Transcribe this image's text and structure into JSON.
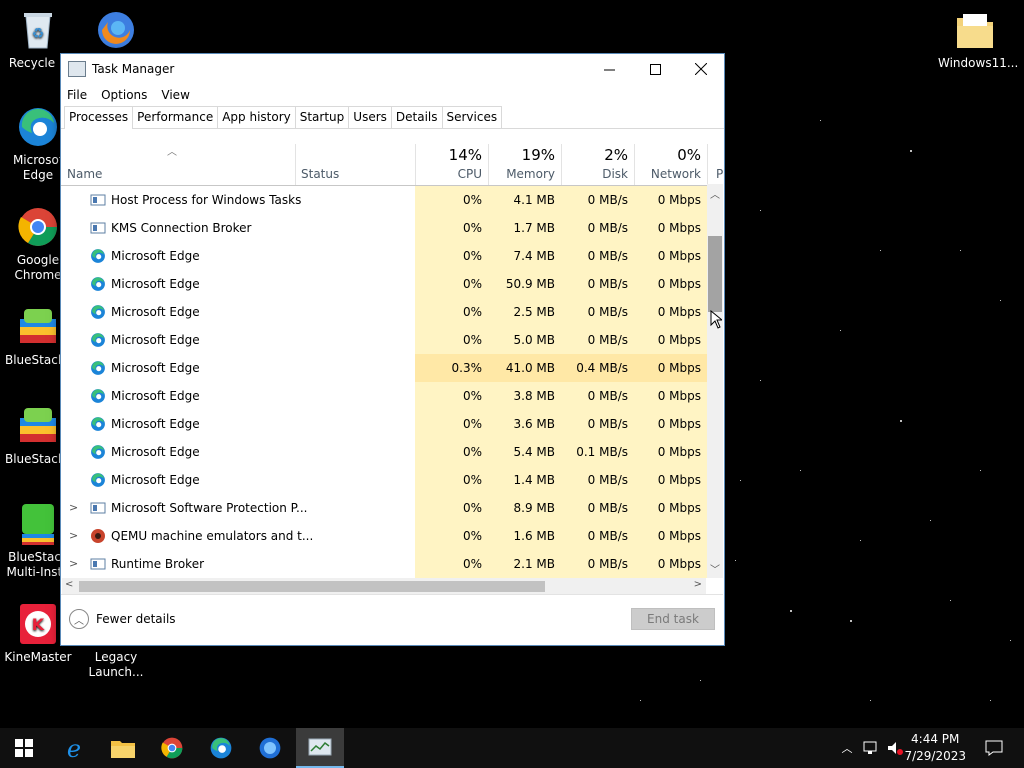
{
  "desktop": {
    "icons": [
      {
        "label": "Recycle B",
        "icon": "recycle-bin-icon"
      },
      {
        "label": "",
        "icon": "firefox-developer-icon"
      },
      {
        "label": "Microsof\nEdge",
        "icon": "edge-icon"
      },
      {
        "label": "Google\nChrome",
        "icon": "chrome-icon"
      },
      {
        "label": "BlueStacks",
        "icon": "bluestacks-icon"
      },
      {
        "label": "BlueStacks",
        "icon": "bluestacks-icon"
      },
      {
        "label": "BlueStack\nMulti-Insta",
        "icon": "bluestacks-multi-icon"
      },
      {
        "label": "KineMaster",
        "icon": "kinemaster-icon"
      },
      {
        "label": "Legacy\nLaunch...",
        "icon": "legacy-launcher-icon"
      },
      {
        "label": "Windows11...",
        "icon": "folder-icon"
      }
    ]
  },
  "window": {
    "title": "Task Manager",
    "menu": [
      "File",
      "Options",
      "View"
    ],
    "tabs": [
      "Processes",
      "Performance",
      "App history",
      "Startup",
      "Users",
      "Details",
      "Services"
    ],
    "active_tab": "Processes",
    "columns": {
      "name": "Name",
      "status": "Status",
      "cpu": {
        "pct": "14%",
        "label": "CPU"
      },
      "memory": {
        "pct": "19%",
        "label": "Memory"
      },
      "disk": {
        "pct": "2%",
        "label": "Disk"
      },
      "network": {
        "pct": "0%",
        "label": "Network"
      },
      "power": {
        "label": "P"
      }
    },
    "rows": [
      {
        "name": "Host Process for Windows Tasks",
        "cpu": "0%",
        "memory": "4.1 MB",
        "disk": "0 MB/s",
        "network": "0 Mbps",
        "icon": "system-app-icon",
        "expandable": false
      },
      {
        "name": "KMS Connection Broker",
        "cpu": "0%",
        "memory": "1.7 MB",
        "disk": "0 MB/s",
        "network": "0 Mbps",
        "icon": "system-app-icon",
        "expandable": false
      },
      {
        "name": "Microsoft Edge",
        "cpu": "0%",
        "memory": "7.4 MB",
        "disk": "0 MB/s",
        "network": "0 Mbps",
        "icon": "edge-icon",
        "expandable": false
      },
      {
        "name": "Microsoft Edge",
        "cpu": "0%",
        "memory": "50.9 MB",
        "disk": "0 MB/s",
        "network": "0 Mbps",
        "icon": "edge-icon",
        "expandable": false
      },
      {
        "name": "Microsoft Edge",
        "cpu": "0%",
        "memory": "2.5 MB",
        "disk": "0 MB/s",
        "network": "0 Mbps",
        "icon": "edge-icon",
        "expandable": false
      },
      {
        "name": "Microsoft Edge",
        "cpu": "0%",
        "memory": "5.0 MB",
        "disk": "0 MB/s",
        "network": "0 Mbps",
        "icon": "edge-icon",
        "expandable": false
      },
      {
        "name": "Microsoft Edge",
        "cpu": "0.3%",
        "memory": "41.0 MB",
        "disk": "0.4 MB/s",
        "network": "0 Mbps",
        "icon": "edge-icon",
        "expandable": false,
        "highlight": true
      },
      {
        "name": "Microsoft Edge",
        "cpu": "0%",
        "memory": "3.8 MB",
        "disk": "0 MB/s",
        "network": "0 Mbps",
        "icon": "edge-icon",
        "expandable": false
      },
      {
        "name": "Microsoft Edge",
        "cpu": "0%",
        "memory": "3.6 MB",
        "disk": "0 MB/s",
        "network": "0 Mbps",
        "icon": "edge-icon",
        "expandable": false
      },
      {
        "name": "Microsoft Edge",
        "cpu": "0%",
        "memory": "5.4 MB",
        "disk": "0.1 MB/s",
        "network": "0 Mbps",
        "icon": "edge-icon",
        "expandable": false
      },
      {
        "name": "Microsoft Edge",
        "cpu": "0%",
        "memory": "1.4 MB",
        "disk": "0 MB/s",
        "network": "0 Mbps",
        "icon": "edge-icon",
        "expandable": false
      },
      {
        "name": "Microsoft Software Protection P...",
        "cpu": "0%",
        "memory": "8.9 MB",
        "disk": "0 MB/s",
        "network": "0 Mbps",
        "icon": "system-app-icon",
        "expandable": true
      },
      {
        "name": "QEMU machine emulators and t...",
        "cpu": "0%",
        "memory": "1.6 MB",
        "disk": "0 MB/s",
        "network": "0 Mbps",
        "icon": "qemu-icon",
        "expandable": true
      },
      {
        "name": "Runtime Broker",
        "cpu": "0%",
        "memory": "2.1 MB",
        "disk": "0 MB/s",
        "network": "0 Mbps",
        "icon": "system-app-icon",
        "expandable": true
      }
    ],
    "footer": {
      "fewer_details": "Fewer details",
      "end_task": "End task"
    }
  },
  "taskbar": {
    "items": [
      "start-icon",
      "internet-explorer-icon",
      "file-explorer-icon",
      "chrome-icon",
      "edge-icon",
      "firefox-icon",
      "task-manager-icon"
    ],
    "time": "4:44 PM",
    "date": "7/29/2023"
  }
}
